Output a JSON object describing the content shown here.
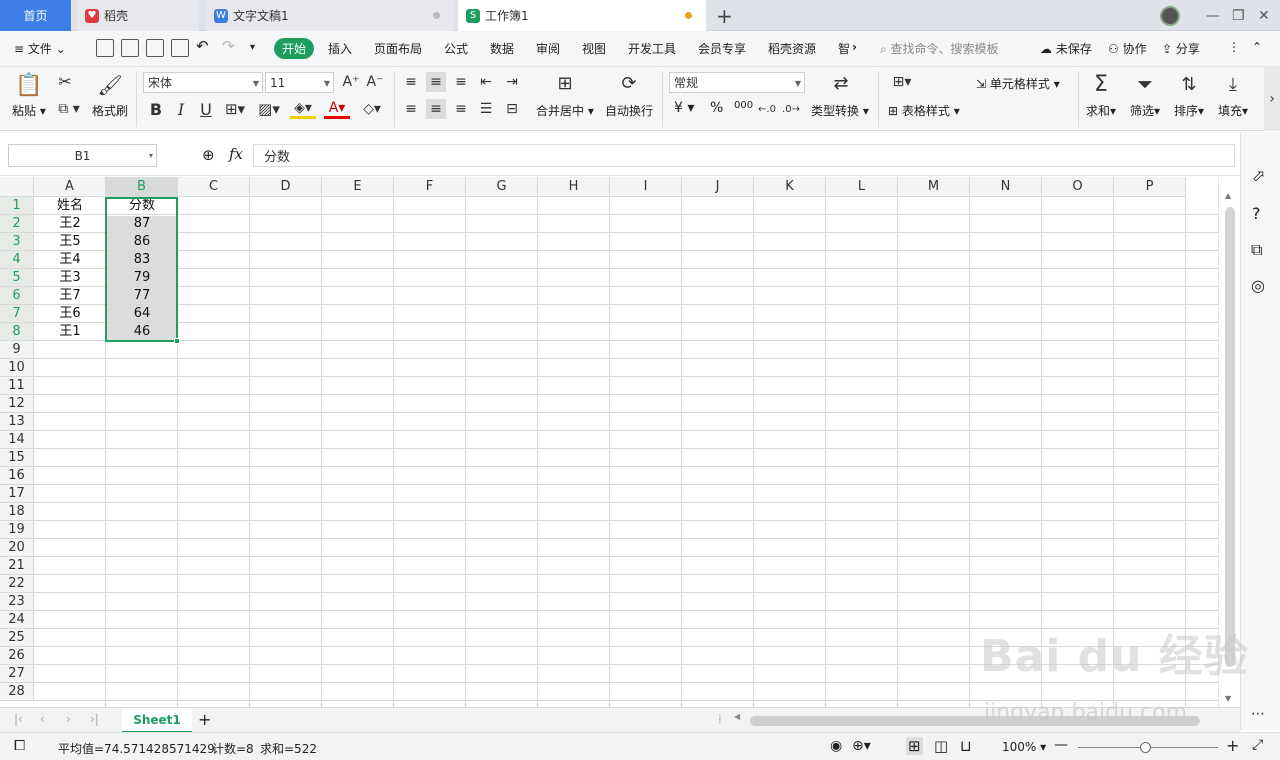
{
  "tabs": {
    "home": "首页",
    "daoke": "稻壳",
    "doc": "文字文稿1",
    "book": "工作簿1"
  },
  "menu": {
    "file": "文件",
    "items": [
      "开始",
      "插入",
      "页面布局",
      "公式",
      "数据",
      "审阅",
      "视图",
      "开发工具",
      "会员专享",
      "稻壳资源",
      "智"
    ],
    "search_placeholder": "查找命令、搜索模板",
    "unsaved": "未保存",
    "collab": "协作",
    "share": "分享"
  },
  "ribbon": {
    "paste": "粘贴",
    "format_painter": "格式刷",
    "font_name": "宋体",
    "font_size": "11",
    "merge_center": "合并居中",
    "wrap": "自动换行",
    "number_format": "常规",
    "type_convert": "类型转换",
    "cell_style": "单元格样式",
    "table_style": "表格样式",
    "sum": "求和",
    "filter": "筛选",
    "sort": "排序",
    "fill": "填充",
    "bold": "B",
    "italic": "I",
    "underline": "U",
    "currency": "¥",
    "percent": "%",
    "thousands": "000"
  },
  "formula": {
    "cell_ref": "B1",
    "fx": "fx",
    "content": "分数"
  },
  "grid": {
    "columns": [
      "A",
      "B",
      "C",
      "D",
      "E",
      "F",
      "G",
      "H",
      "I",
      "J",
      "K",
      "L",
      "M",
      "N",
      "O",
      "P"
    ],
    "rows": [
      "1",
      "2",
      "3",
      "4",
      "5",
      "6",
      "7",
      "8",
      "9",
      "10",
      "11",
      "12",
      "13",
      "14",
      "15",
      "16",
      "17",
      "18",
      "19",
      "20",
      "21",
      "22",
      "23",
      "24",
      "25",
      "26",
      "27",
      "28"
    ],
    "data": [
      [
        "姓名",
        "分数"
      ],
      [
        "王2",
        "87"
      ],
      [
        "王5",
        "86"
      ],
      [
        "王4",
        "83"
      ],
      [
        "王3",
        "79"
      ],
      [
        "王7",
        "77"
      ],
      [
        "王6",
        "64"
      ],
      [
        "王1",
        "46"
      ]
    ]
  },
  "sheet": {
    "name": "Sheet1"
  },
  "status": {
    "average": "平均值=74.571428571429",
    "count": "计数=8",
    "sum": "求和=522",
    "zoom": "100%"
  },
  "watermark": {
    "text": "Bai du 经验",
    "url": "jingyan.baidu.com"
  },
  "colors": {
    "accent": "#1e9e5e",
    "tab_home": "#3c7de8"
  }
}
